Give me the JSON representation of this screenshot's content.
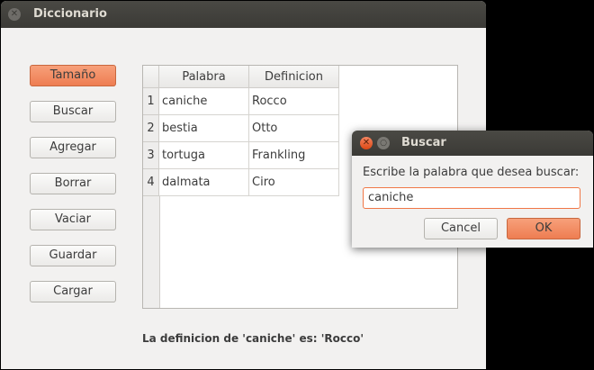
{
  "main_window": {
    "title": "Diccionario",
    "buttons": [
      "Tamaño",
      "Buscar",
      "Agregar",
      "Borrar",
      "Vaciar",
      "Guardar",
      "Cargar"
    ],
    "active_button": "Tamaño",
    "table": {
      "headers": [
        "Palabra",
        "Definicion"
      ],
      "row_numbers": [
        "1",
        "2",
        "3",
        "4"
      ],
      "rows": [
        [
          "caniche",
          "Rocco"
        ],
        [
          "bestia",
          "Otto"
        ],
        [
          "tortuga",
          "Frankling"
        ],
        [
          "dalmata",
          "Ciro"
        ]
      ]
    },
    "status": "La definicion de 'caniche' es: 'Rocco'"
  },
  "dialog": {
    "title": "Buscar",
    "prompt": "Escribe la palabra que desea buscar:",
    "input_value": "caniche",
    "cancel_label": "Cancel",
    "ok_label": "OK"
  },
  "colors": {
    "accent": "#ee7d52",
    "titlebar": "#3c3b37",
    "window_bg": "#f2f1f0"
  }
}
